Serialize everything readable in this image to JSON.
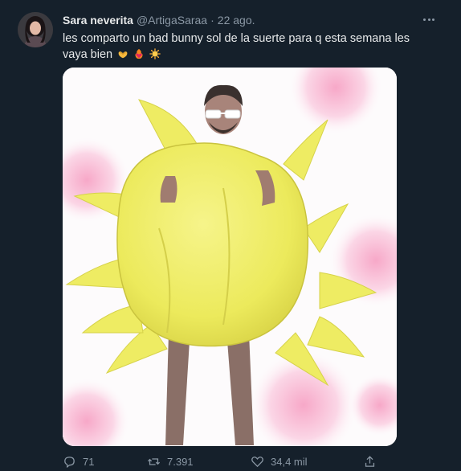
{
  "tweet": {
    "author_name": "Sara neverita",
    "handle": "@ArtigaSaraa",
    "separator": "·",
    "date": "22 ago.",
    "text_line": "les comparto un bad bunny sol de la suerte para q esta semana les vaya bien",
    "emojis": [
      "heart-hands-emoji",
      "heart-on-fire-emoji",
      "sun-emoji"
    ]
  },
  "actions": {
    "reply_count": "71",
    "retweet_count": "7.391",
    "like_count": "34,4 mil"
  },
  "colors": {
    "background": "#15202b",
    "secondary_text": "#8b98a5",
    "primary_text": "#e7e9ea",
    "costume_yellow": "#f2ee6a"
  }
}
